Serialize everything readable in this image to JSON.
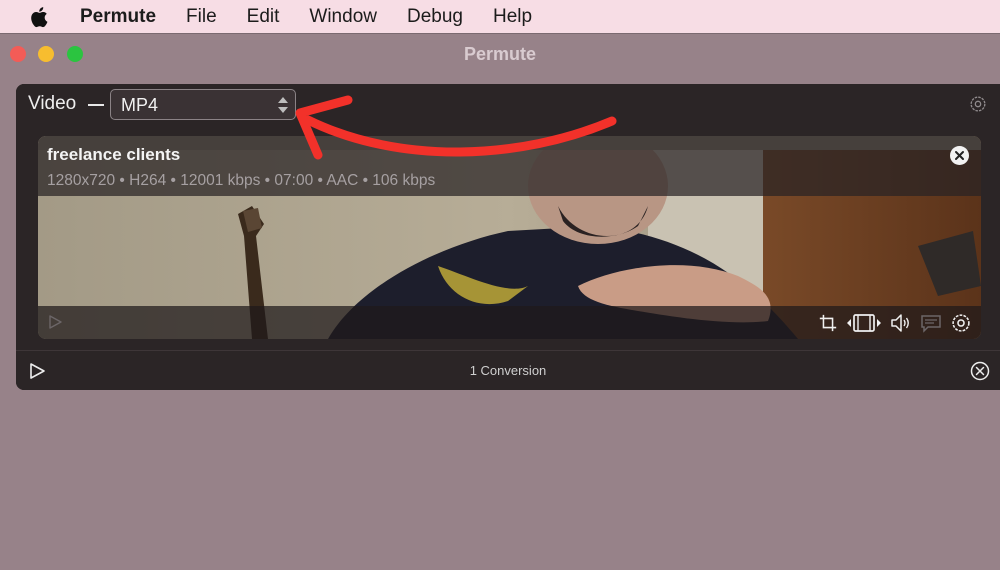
{
  "menubar": {
    "apple_icon": "apple-logo-icon",
    "items": [
      "Permute",
      "File",
      "Edit",
      "Window",
      "Debug",
      "Help"
    ]
  },
  "window": {
    "title": "Permute"
  },
  "toolbar": {
    "media_type": "Video",
    "format_value": "MP4",
    "settings_icon": "gear-icon"
  },
  "file": {
    "name": "freelance clients",
    "meta": "1280x720 • H264 • 12001 kbps • 07:00 • AAC • 106 kbps"
  },
  "card_controls": [
    "play-icon",
    "crop-icon",
    "trim-film-icon",
    "volume-icon",
    "subtitles-icon",
    "gear-icon"
  ],
  "footer": {
    "conversion_count": "1 Conversion"
  },
  "colors": {
    "annotation_arrow": "#f2312a",
    "menubar_bg": "#f7dde5",
    "window_bg": "#978289",
    "panel_bg": "#2b2526"
  }
}
